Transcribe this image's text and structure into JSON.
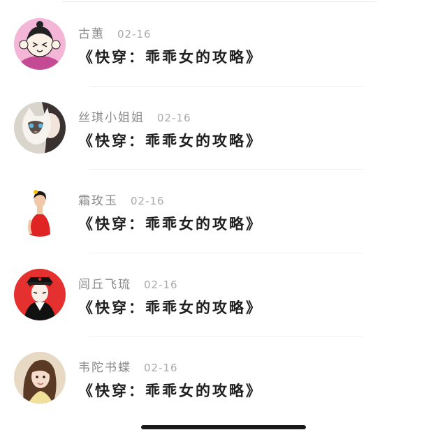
{
  "comments": [
    {
      "username": "古蕙",
      "date": "02-16",
      "message": "《快穿：乖乖女的攻略》",
      "avatar_icon": "cartoon-girl-avatar",
      "avatar_bg": "#f3b6d6"
    },
    {
      "username": "丝琪小姐姐",
      "date": "02-16",
      "message": "《快穿：乖乖女的攻略》",
      "avatar_icon": "cat-and-girl-avatar",
      "avatar_bg": "#d9d4cc"
    },
    {
      "username": "霜玫玉",
      "date": "02-16",
      "message": "《快穿：乖乖女的攻略》",
      "avatar_icon": "woman-red-dress-avatar",
      "avatar_bg": "#ffffff"
    },
    {
      "username": "闾丘飞琉",
      "date": "02-16",
      "message": "《快穿：乖乖女的攻略》",
      "avatar_icon": "anime-officer-avatar",
      "avatar_bg": "#e53030"
    },
    {
      "username": "韦陀书蝶",
      "date": "02-16",
      "message": "《快穿：乖乖女的攻略》",
      "avatar_icon": "long-hair-woman-avatar",
      "avatar_bg": "#e8d9c4"
    }
  ]
}
